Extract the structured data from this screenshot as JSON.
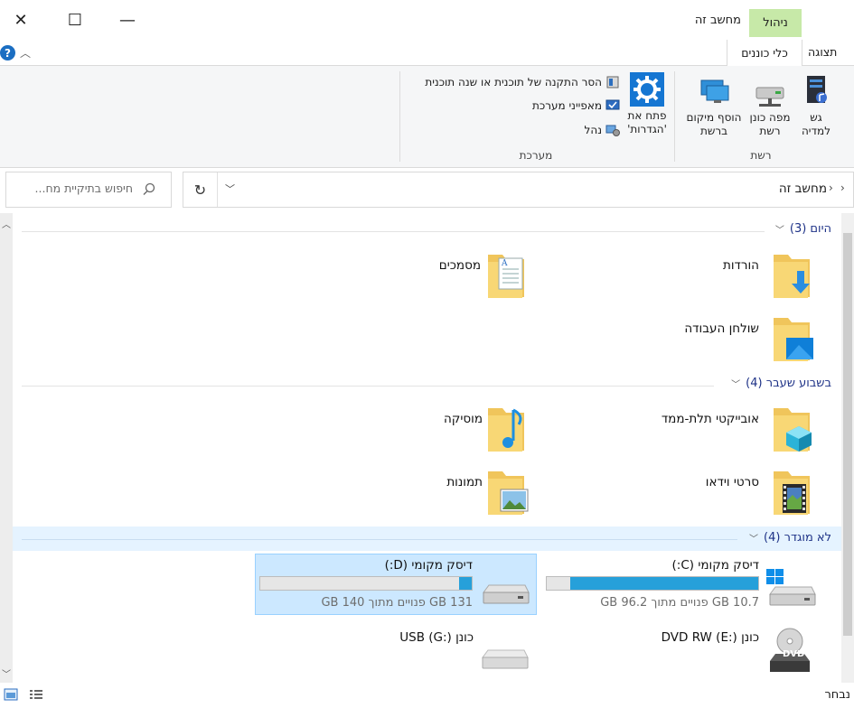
{
  "window": {
    "title": "מחשב זה",
    "close_glyph": "✕",
    "maximize_glyph": "☐",
    "minimize_glyph": "—"
  },
  "ribbon_tabs": {
    "manage": "ניהול",
    "drive_tools": "כלי כוננים",
    "view": "תצוגה"
  },
  "ribbon": {
    "network_group": {
      "label": "רשת",
      "media_access": "גש\nלמדיה",
      "map_drive": "מפה כונן\nרשת",
      "add_location": "הוסף מיקום\nברשת"
    },
    "system_group": {
      "label": "מערכת",
      "open_settings": "פתח את\n'הגדרות'",
      "uninstall": "הסר התקנה של תוכנית או שנה תוכנית",
      "system_properties": "מאפייני מערכת",
      "manage": "נהל"
    }
  },
  "address_bar": {
    "path": "מחשב זה",
    "search_placeholder": "חיפוש בתיקיית מח..."
  },
  "sections": {
    "today": "היום (3)",
    "last_week": "בשבוע שעבר (4)",
    "unsorted": "לא מוגדר (4)"
  },
  "folders": {
    "downloads": "הורדות",
    "documents": "מסמכים",
    "desktop": "שולחן העבודה",
    "objects3d": "אובייקטי תלת-ממד",
    "music": "מוסיקה",
    "videos": "סרטי וידאו",
    "pictures": "תמונות"
  },
  "drives": {
    "c": {
      "name": "דיסק מקומי (C:)",
      "free": "10.7 GB פנויים מתוך 96.2 GB",
      "used_fraction": 0.89
    },
    "d": {
      "name": "דיסק מקומי (D:)",
      "free": "131 GB פנויים מתוך 140 GB",
      "used_fraction": 0.06
    },
    "e": {
      "name": "כונן DVD RW (E:)",
      "badge": "DVD"
    },
    "g": {
      "name": "כונן USB (G:)"
    }
  },
  "status": {
    "selected": "נבחר"
  },
  "colors": {
    "accent": "#26a0da",
    "manage_tab": "#c7e9a8",
    "section_text": "#1e3287",
    "selection": "#cce8ff"
  }
}
